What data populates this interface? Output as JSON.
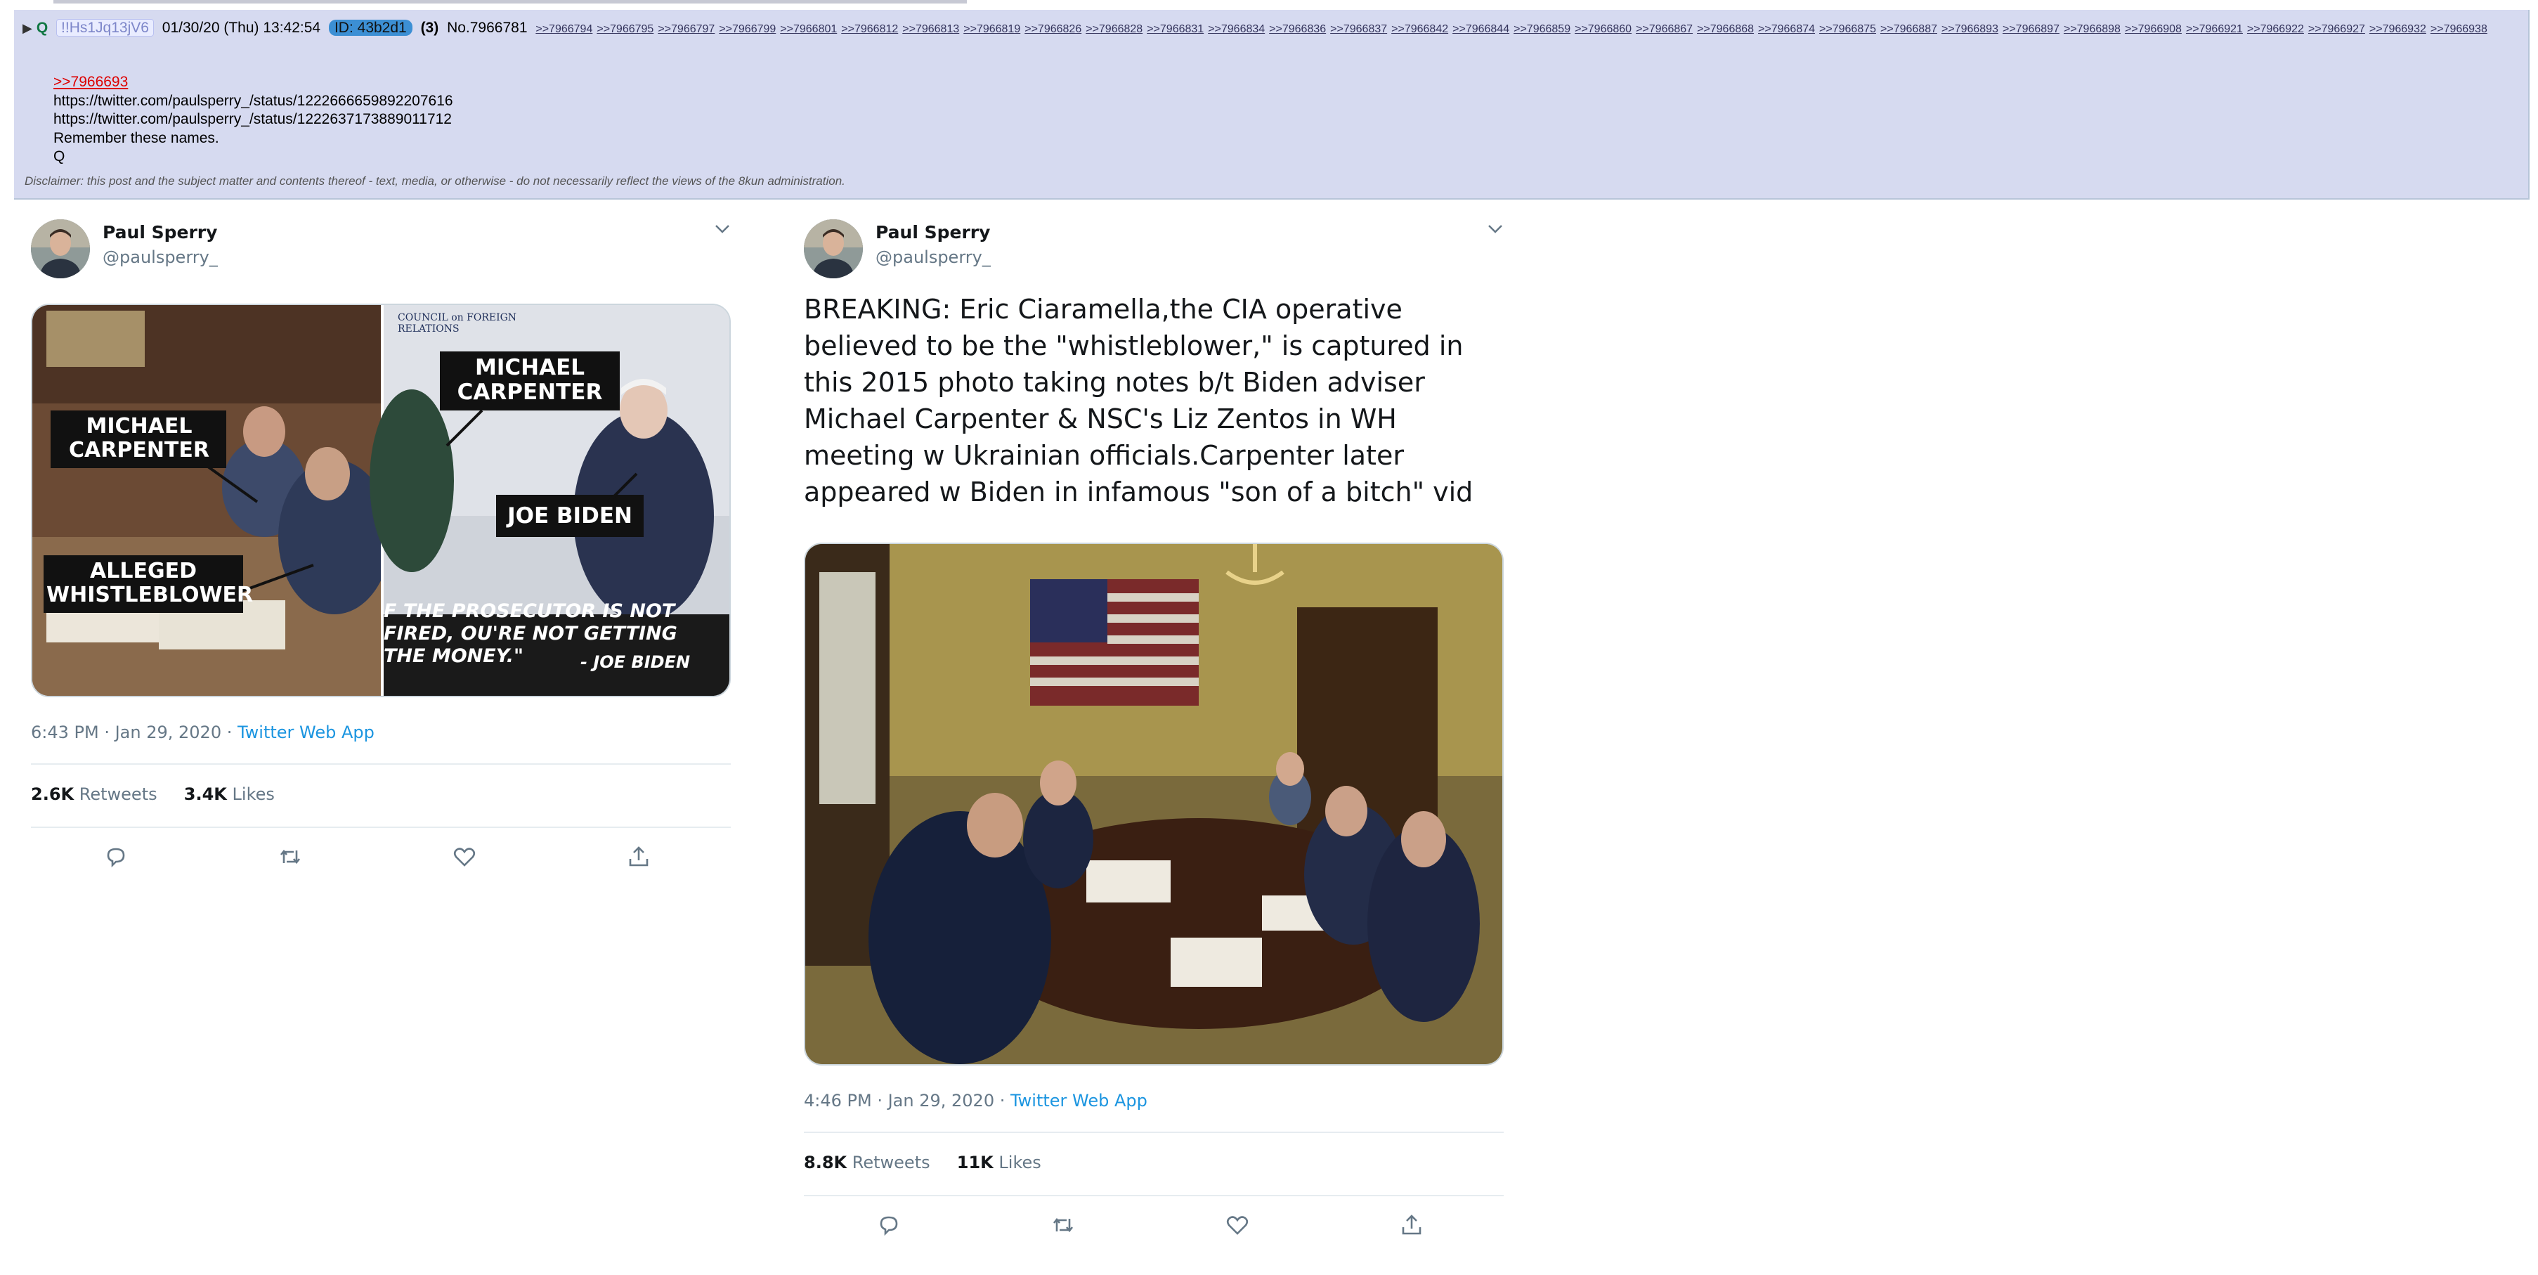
{
  "post": {
    "arrow": "▶",
    "name": "Q",
    "tripcode": "!!Hs1Jq13jV6",
    "datetime": "01/30/20 (Thu) 13:42:54",
    "id_badge": "ID: 43b2d1",
    "reply_count": "(3)",
    "number": "No.7966781",
    "backlinks": [
      ">>7966794",
      ">>7966795",
      ">>7966797",
      ">>7966799",
      ">>7966801",
      ">>7966812",
      ">>7966813",
      ">>7966819",
      ">>7966826",
      ">>7966828",
      ">>7966831",
      ">>7966834",
      ">>7966836",
      ">>7966837",
      ">>7966842",
      ">>7966844",
      ">>7966859",
      ">>7966860",
      ">>7966867",
      ">>7966868",
      ">>7966874",
      ">>7966875",
      ">>7966887",
      ">>7966893",
      ">>7966897",
      ">>7966898",
      ">>7966908",
      ">>7966921",
      ">>7966922",
      ">>7966927",
      ">>7966932",
      ">>7966938"
    ],
    "quote_link": ">>7966693",
    "lines": [
      "https://twitter.com/paulsperry_/status/1222666659892207616",
      "https://twitter.com/paulsperry_/status/1222637173889011712",
      "Remember these names.",
      "Q"
    ],
    "disclaimer": "Disclaimer: this post and the subject matter and contents thereof - text, media, or otherwise - do not necessarily reflect the views of the 8kun administration."
  },
  "tweets": [
    {
      "author": "Paul Sperry",
      "handle": "@paulsperry_",
      "text": "",
      "image_labels": {
        "left_name": "MICHAEL CARPENTER",
        "left_role": "ALLEGED WHISTLEBLOWER",
        "right_name": "MICHAEL CARPENTER",
        "right_subject": "JOE BIDEN",
        "quote": "F THE PROSECUTOR IS NOT FIRED, OU'RE NOT GETTING THE MONEY.\"",
        "quote_attr": "- JOE BIDEN",
        "banner": "COUNCIL on FOREIGN RELATIONS"
      },
      "time": "6:43 PM · Jan 29, 2020",
      "app": "Twitter Web App",
      "retweets": "2.6K",
      "retweets_label": "Retweets",
      "likes": "3.4K",
      "likes_label": "Likes"
    },
    {
      "author": "Paul Sperry",
      "handle": "@paulsperry_",
      "text": "BREAKING: Eric Ciaramella,the CIA operative believed to be the \"whistleblower,\" is captured in this 2015 photo taking notes b/t Biden adviser Michael Carpenter & NSC's Liz Zentos in WH meeting w Ukrainian officials.Carpenter later appeared w Biden in infamous \"son of a bitch\" vid",
      "time": "4:46 PM · Jan 29, 2020",
      "app": "Twitter Web App",
      "retweets": "8.8K",
      "retweets_label": "Retweets",
      "likes": "11K",
      "likes_label": "Likes"
    }
  ],
  "icons": [
    "reply-icon",
    "retweet-icon",
    "like-icon",
    "share-icon",
    "chevron-down-icon"
  ],
  "colors": {
    "post_bg": "#d6daf0",
    "link_blue": "#1b95e0",
    "quote_red": "#dd0000",
    "id_badge": "#3c8fd4"
  }
}
